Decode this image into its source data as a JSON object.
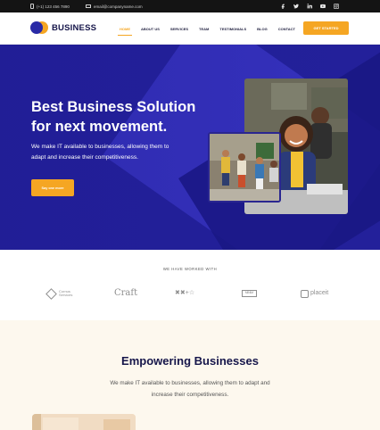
{
  "topbar": {
    "phone": "(+1) 123 456 7890",
    "email": "email@companyname.com",
    "socials": [
      "facebook-icon",
      "twitter-icon",
      "linkedin-icon",
      "youtube-icon",
      "instagram-icon"
    ]
  },
  "nav": {
    "logo_text": "BUSINESS",
    "items": [
      "HOME",
      "ABOUT US",
      "SERVICES",
      "TEAM",
      "TESTIMONIALS",
      "BLOG",
      "CONTACT"
    ],
    "active": "HOME",
    "cta": "GET STARTED"
  },
  "hero": {
    "title": "Best Business Solution for next movement.",
    "subtitle": "We make IT available to businesses, allowing them to adapt and increase their competitiveness.",
    "button": "Say one more"
  },
  "partners": {
    "title": "WE HAVE WORKED WITH",
    "brands": [
      "Cornus Services",
      "Craft",
      "✖✖+☆",
      "ᴹᴵᴺᴵᴹ",
      "placeit"
    ]
  },
  "empower": {
    "title": "Empowering Businesses",
    "subtitle": "We make IT available to businesses, allowing them to adapt and increase their competitiveness."
  },
  "colors": {
    "accent": "#f5a623",
    "hero_bg": "#23209a",
    "navy": "#16164a",
    "cream": "#fdf8ee"
  }
}
